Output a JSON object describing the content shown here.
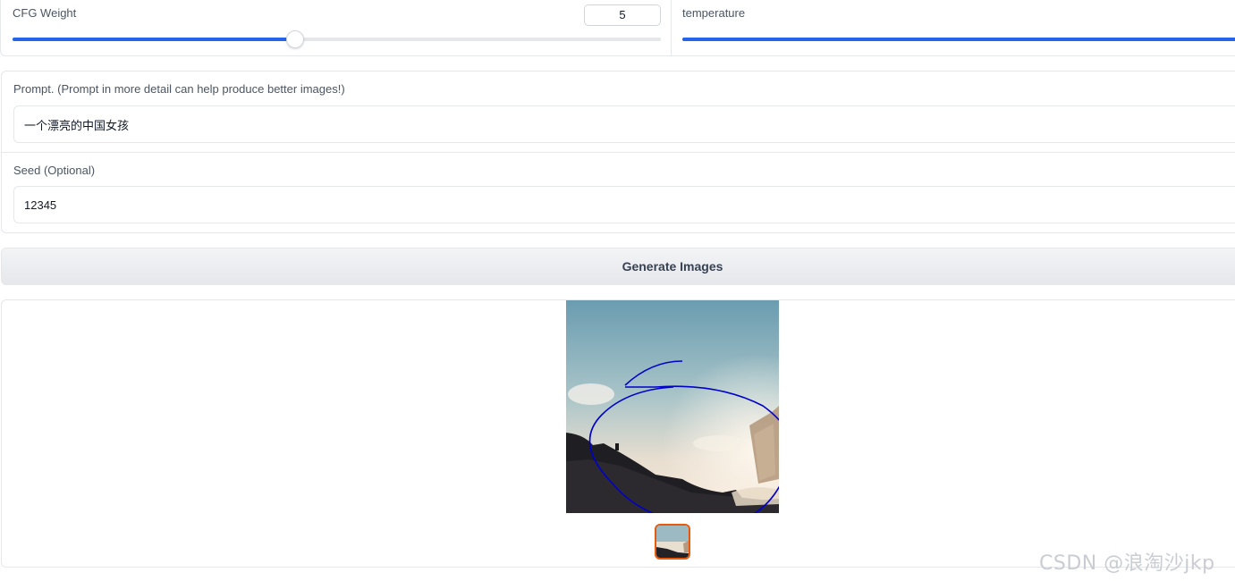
{
  "sliders": {
    "cfg": {
      "label": "CFG Weight",
      "value": "5",
      "level": 0.436
    },
    "temperature": {
      "label": "temperature",
      "level": 1.0
    }
  },
  "form": {
    "prompt": {
      "label": "Prompt. (Prompt in more detail can help produce better images!)",
      "value": "一个漂亮的中国女孩"
    },
    "seed": {
      "label": "Seed (Optional)",
      "value": "12345"
    }
  },
  "actions": {
    "generate_label": "Generate Images"
  },
  "gallery": {
    "thumbnail_count": 1,
    "selected_index": 0
  },
  "colors": {
    "accent": "#2563eb",
    "selected_border": "#ea580c",
    "annotation": "#0000cc"
  },
  "watermark": "CSDN @浪淘沙jkp"
}
